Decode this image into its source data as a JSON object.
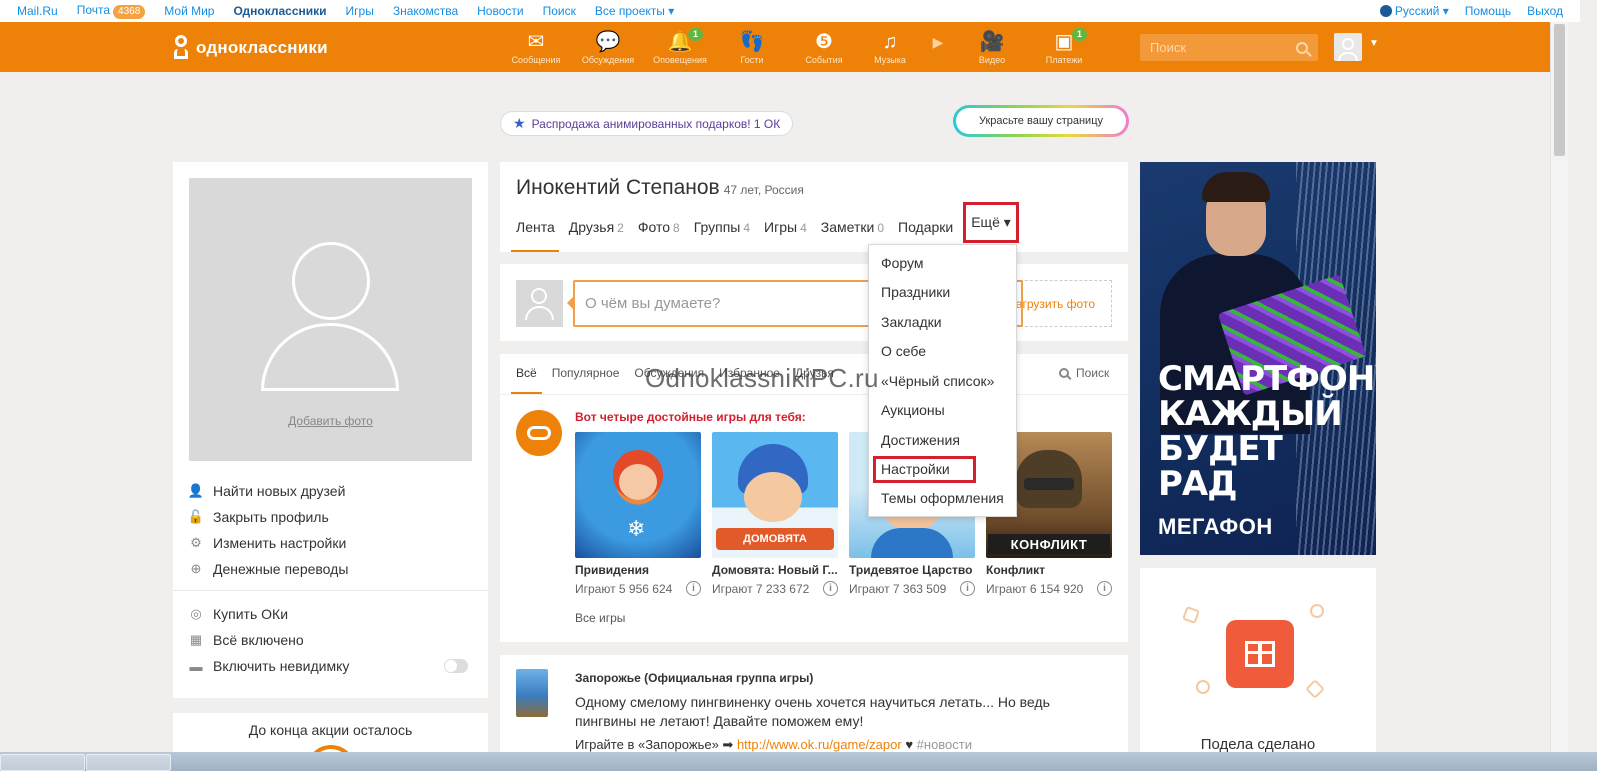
{
  "topbar": {
    "links": [
      "Mail.Ru",
      "Почта",
      "Мой Мир",
      "Одноклассники",
      "Игры",
      "Знакомства",
      "Новости",
      "Поиск",
      "Все проекты ▾"
    ],
    "mail_count": "4368",
    "language": "Русский ▾",
    "help": "Помощь",
    "logout": "Выход"
  },
  "header": {
    "logo_text": "одноклассники",
    "nav": [
      {
        "label": "Сообщения",
        "icon": "envelope-icon",
        "glyph": "✉",
        "badge": ""
      },
      {
        "label": "Обсуждения",
        "icon": "chat-bubbles-icon",
        "glyph": "💬",
        "badge": ""
      },
      {
        "label": "Оповещения",
        "icon": "bell-icon",
        "glyph": "🔔",
        "badge": "1"
      },
      {
        "label": "Гости",
        "icon": "footprints-icon",
        "glyph": "👣",
        "badge": ""
      },
      {
        "label": "События",
        "icon": "events-icon",
        "glyph": "❺",
        "badge": ""
      },
      {
        "label": "Музыка",
        "icon": "music-note-icon",
        "glyph": "♫",
        "badge": ""
      },
      {
        "label": "",
        "icon": "play-icon",
        "glyph": "▶",
        "badge": ""
      },
      {
        "label": "Видео",
        "icon": "video-camera-icon",
        "glyph": "🎥",
        "badge": ""
      },
      {
        "label": "Платежи",
        "icon": "wallet-icon",
        "glyph": "▣",
        "badge": "1"
      }
    ],
    "search_placeholder": "Поиск"
  },
  "promo": {
    "sale_text": "Распродажа анимированных подарков! 1 ОК",
    "decorate_text": "Украсьте вашу страницу"
  },
  "left": {
    "add_photo": "Добавить фото",
    "menu": [
      {
        "label": "Найти новых друзей",
        "icon": "person-icon",
        "glyph": "👤"
      },
      {
        "label": "Закрыть профиль",
        "icon": "lock-icon",
        "glyph": "🔓"
      },
      {
        "label": "Изменить настройки",
        "icon": "gear-icon",
        "glyph": "⚙"
      },
      {
        "label": "Денежные переводы",
        "icon": "money-icon",
        "glyph": "⊕"
      }
    ],
    "menu2": [
      {
        "label": "Купить ОКи",
        "icon": "coin-icon",
        "glyph": "◎"
      },
      {
        "label": "Всё включено",
        "icon": "gift-icon",
        "glyph": "▦"
      },
      {
        "label": "Включить невидимку",
        "icon": "hat-icon",
        "glyph": "▬"
      }
    ],
    "promo_timer": "До конца акции осталось"
  },
  "profile": {
    "name": "Инокентий Степанов",
    "meta": "47 лет, Россия",
    "tabs": [
      {
        "label": "Лента",
        "count": ""
      },
      {
        "label": "Друзья",
        "count": "2"
      },
      {
        "label": "Фото",
        "count": "8"
      },
      {
        "label": "Группы",
        "count": "4"
      },
      {
        "label": "Игры",
        "count": "4"
      },
      {
        "label": "Заметки",
        "count": "0"
      },
      {
        "label": "Подарки",
        "count": ""
      }
    ],
    "more": "Ещё ▾"
  },
  "dropdown": [
    "Форум",
    "Праздники",
    "Закладки",
    "О себе",
    "«Чёрный список»",
    "Аукционы",
    "Достижения",
    "Настройки",
    "Темы оформления"
  ],
  "post": {
    "placeholder": "О чём вы думаете?",
    "upload": "агрузить фото"
  },
  "feed": {
    "tabs": [
      "Всё",
      "Популярное",
      "Обсуждения",
      "Избранное",
      "Друзья"
    ],
    "search": "Поиск",
    "games_title": "Вот четыре достойные игры для тебя:",
    "games": [
      {
        "name": "Привидения",
        "plays": "Играют 5 956 624"
      },
      {
        "name": "Домовята: Новый Г...",
        "plays": "Играют 7 233 672"
      },
      {
        "name": "Тридевятое Царство",
        "plays": "Играют 7 363 509"
      },
      {
        "name": "Конфликт",
        "plays": "Играют 6 154 920"
      }
    ],
    "game_labels": [
      "ДОМОВЯТА",
      "КОНФЛИКТ"
    ],
    "all_games": "Все игры"
  },
  "group_post": {
    "title": "Запорожье (Официальная группа игры)",
    "text": "Одному смелому пингвиненку очень хочется научиться летать... Но ведь пингвины не летают! Давайте поможем ему!",
    "play_prefix": "Играйте в «Запорожье» ➡",
    "link": "http://www.ok.ru/game/zapor",
    "tag": "#новости"
  },
  "watermark": "OdnoklassnikiPC.ru",
  "ad": {
    "slogan": "СМАРТФОНУ КАЖДЫЙ БУДЕТ РАД",
    "brand": "МЕГАФОН",
    "caption": "Подела сделано"
  },
  "colors": {
    "brand_orange": "#ee8208",
    "highlight_red": "#d3202e",
    "link_blue": "#168de2"
  }
}
